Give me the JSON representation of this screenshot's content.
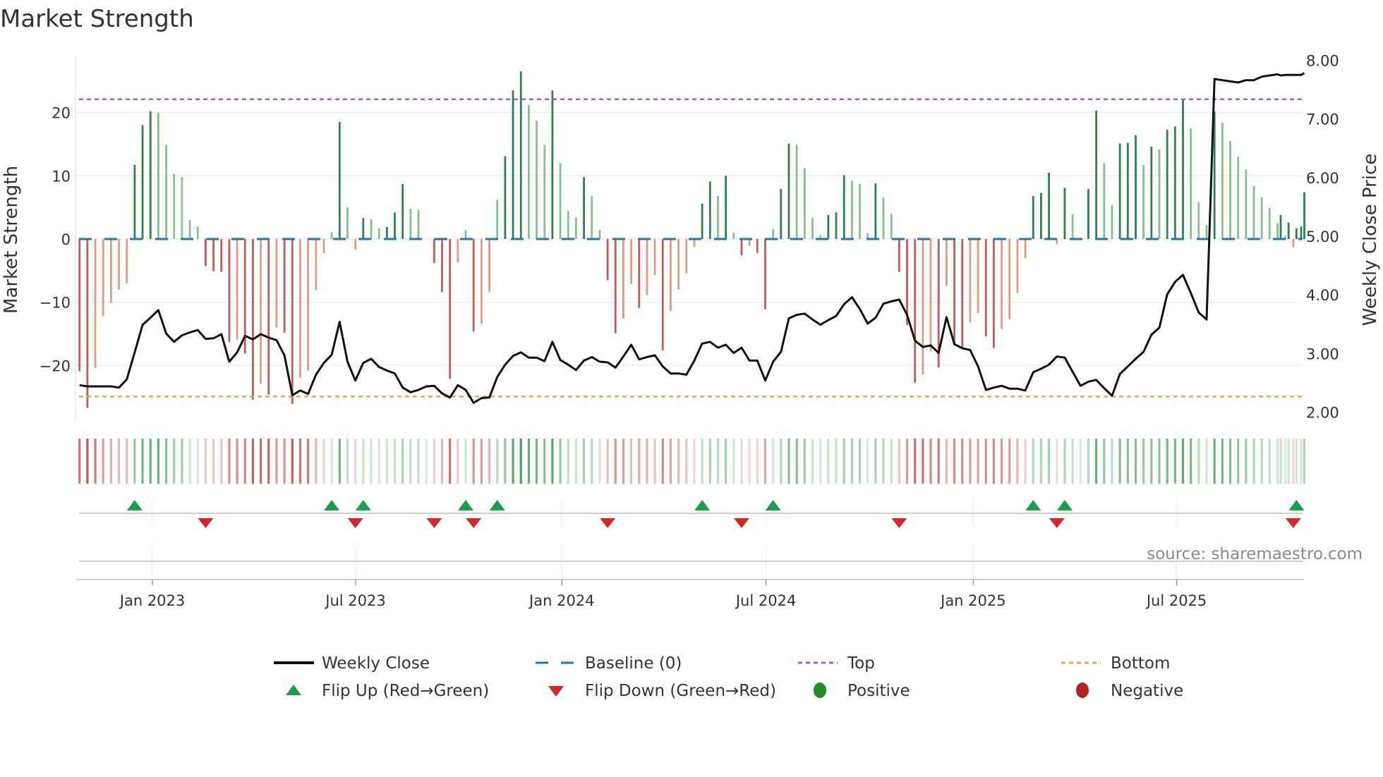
{
  "title": "Market Strength",
  "source": "source: sharemaestro.com",
  "legend": {
    "weekly_close": "Weekly Close",
    "baseline": "Baseline (0)",
    "top": "Top",
    "bottom": "Bottom",
    "flip_up": "Flip Up (Red→Green)",
    "flip_down": "Flip Down (Green→Red)",
    "positive": "Positive",
    "negative": "Negative"
  },
  "colors": {
    "pos_dark": "#2f7f50",
    "pos_light": "#86c08a",
    "neg_dark": "#c25b5b",
    "neg_light": "#e39a82",
    "baseline": "#1f77b4",
    "top": "#9b5de5",
    "bottom": "#f0a050",
    "close": "#111111",
    "flip_up": "#1a9e4a",
    "flip_down": "#d62728",
    "positive": "#228b22",
    "negative": "#b22222"
  },
  "chart_data": {
    "type": "bar",
    "title": "Market Strength",
    "ylabel": "Market Strength",
    "ylabel_right": "Weekly Close Price",
    "y_ticks": [
      "−20",
      "−10",
      "0",
      "10",
      "20"
    ],
    "y_tick_values": [
      -20,
      -10,
      0,
      10,
      20
    ],
    "ylim": [
      -28,
      28
    ],
    "y_right_ticks": [
      "2.00",
      "3.00",
      "4.00",
      "5.00",
      "6.00",
      "7.00",
      "8.00"
    ],
    "y_right_tick_values": [
      2,
      3,
      4,
      5,
      6,
      7,
      8
    ],
    "ylim_right": [
      2,
      8
    ],
    "top_level": 22.1,
    "bottom_level": -24.9,
    "baseline": 0,
    "x_unit": "weeks since first observation",
    "x_ticks": [
      {
        "label": "Jan 2023",
        "week": 9.25
      },
      {
        "label": "Jul 2023",
        "week": 35.03
      },
      {
        "label": "Jan 2024",
        "week": 61.2
      },
      {
        "label": "Jul 2024",
        "week": 87.1
      },
      {
        "label": "Jan 2025",
        "week": 113.4
      },
      {
        "label": "Jul 2025",
        "week": 139.2
      }
    ],
    "x": [
      0,
      1,
      2,
      3,
      4,
      5,
      6,
      7,
      8,
      9,
      10,
      11,
      12,
      13,
      14,
      15,
      16,
      17,
      18,
      19,
      20,
      21,
      22,
      23,
      24,
      25,
      26,
      27,
      28,
      29,
      30,
      31,
      32,
      33,
      34,
      35,
      36,
      37,
      38,
      39,
      40,
      41,
      42,
      43,
      44,
      45,
      46,
      47,
      48,
      49,
      50,
      51,
      52,
      53,
      54,
      55,
      56,
      57,
      58,
      59,
      60,
      61,
      62,
      63,
      64,
      65,
      66,
      67,
      68,
      69,
      70,
      71,
      72,
      73,
      74,
      75,
      76,
      77,
      78,
      79,
      80,
      81,
      82,
      83,
      84,
      85,
      86,
      87,
      88,
      89,
      90,
      91,
      92,
      93,
      94,
      95,
      96,
      97,
      98,
      99,
      100,
      101,
      102,
      103,
      104,
      105,
      106,
      107,
      108,
      109,
      110,
      111,
      112,
      113,
      114,
      115,
      116,
      117,
      118,
      119,
      120,
      121,
      122,
      123,
      124,
      125,
      126,
      127,
      128,
      129,
      130,
      131,
      132,
      133,
      134,
      135,
      136,
      137,
      138,
      139,
      140,
      141,
      142,
      143,
      144,
      145,
      146,
      147,
      148,
      149,
      150,
      151,
      152,
      152.4,
      153,
      153.4,
      154,
      154.4,
      155,
      155.4
    ],
    "series": [
      {
        "name": "Market Strength",
        "values": [
          -20.9,
          -26.7,
          -20.4,
          -12.2,
          -10.1,
          -8.0,
          -7.0,
          11.7,
          18.0,
          20.2,
          20.0,
          14.9,
          10.3,
          9.8,
          3.0,
          2.0,
          -4.3,
          -5.1,
          -5.2,
          -16.3,
          -15.9,
          -18.1,
          -25.4,
          -22.9,
          -24.6,
          -14.0,
          -14.8,
          -26.1,
          -21.9,
          -20.8,
          -8.1,
          -2.2,
          1.1,
          18.5,
          5.0,
          -1.7,
          3.3,
          3.1,
          1.7,
          1.9,
          4.2,
          8.7,
          4.8,
          4.6,
          0,
          -3.8,
          -8.4,
          -22.1,
          -3.7,
          1.4,
          -14.6,
          -13.4,
          -8.4,
          6.2,
          13.1,
          23.5,
          26.5,
          21.2,
          18.7,
          14.9,
          23.5,
          12.0,
          4.4,
          3.4,
          9.8,
          6.8,
          1.4,
          -6.5,
          -14.9,
          -12.6,
          -7.1,
          -10.9,
          -8.9,
          -5.7,
          -17.6,
          -11.4,
          -8.0,
          -5.4,
          -1.3,
          5.6,
          9.1,
          6.8,
          10.0,
          1.0,
          -2.6,
          -1.1,
          -2.2,
          -11.1,
          1.6,
          7.9,
          15.1,
          14.9,
          11.2,
          3.3,
          0.6,
          3.8,
          4.2,
          10.1,
          9.2,
          8.7,
          0.9,
          8.8,
          6.6,
          4.0,
          -5.2,
          -13.6,
          -22.7,
          -21.4,
          -17.8,
          -20.3,
          -7.4,
          -16.8,
          -17.2,
          -13.2,
          -11.7,
          -15.4,
          -17.2,
          -14.2,
          -12.7,
          -8.5,
          -3.0,
          6.8,
          7.3,
          10.5,
          -0.8,
          8.1,
          3.9,
          0,
          7.9,
          20.3,
          12.0,
          5.4,
          15.1,
          15.2,
          16.4,
          11.7,
          14.6,
          14.2,
          17.3,
          17.8,
          22.2,
          17.5,
          5.8,
          2.2,
          20.2,
          18.4,
          15.5,
          13.0,
          11.0,
          8.4,
          6.6,
          4.9,
          2.5,
          3.8,
          0.5,
          2.6,
          -1.3,
          1.7,
          2.0,
          7.4
        ]
      },
      {
        "name": "Weekly Close",
        "axis": "right",
        "values": [
          2.46,
          2.44,
          2.44,
          2.44,
          2.44,
          2.42,
          2.56,
          3.02,
          3.49,
          3.61,
          3.74,
          3.34,
          3.2,
          3.31,
          3.36,
          3.4,
          3.25,
          3.26,
          3.33,
          2.86,
          3.02,
          3.3,
          3.24,
          3.33,
          3.27,
          3.23,
          2.97,
          2.29,
          2.37,
          2.31,
          2.64,
          2.84,
          2.98,
          3.54,
          2.86,
          2.54,
          2.84,
          2.91,
          2.77,
          2.71,
          2.66,
          2.42,
          2.34,
          2.38,
          2.44,
          2.45,
          2.32,
          2.25,
          2.46,
          2.38,
          2.16,
          2.24,
          2.25,
          2.6,
          2.81,
          2.96,
          3.02,
          2.93,
          2.93,
          2.87,
          3.2,
          2.89,
          2.81,
          2.72,
          2.88,
          2.94,
          2.86,
          2.85,
          2.76,
          2.95,
          3.15,
          2.9,
          2.94,
          2.97,
          2.78,
          2.66,
          2.66,
          2.64,
          2.88,
          3.17,
          3.2,
          3.1,
          3.15,
          3.01,
          3.1,
          2.88,
          2.88,
          2.54,
          2.86,
          3.03,
          3.6,
          3.66,
          3.68,
          3.58,
          3.49,
          3.57,
          3.64,
          3.84,
          3.96,
          3.76,
          3.51,
          3.61,
          3.85,
          3.89,
          3.92,
          3.66,
          3.22,
          3.11,
          3.14,
          3.01,
          3.62,
          3.16,
          3.09,
          3.06,
          2.78,
          2.38,
          2.42,
          2.45,
          2.4,
          2.4,
          2.37,
          2.68,
          2.74,
          2.81,
          2.95,
          2.93,
          2.69,
          2.45,
          2.52,
          2.55,
          2.41,
          2.28,
          2.65,
          2.78,
          2.91,
          3.03,
          3.32,
          3.44,
          4.01,
          4.22,
          4.34,
          4.03,
          3.7,
          3.58,
          7.68,
          7.66,
          7.64,
          7.62,
          7.66,
          7.66,
          7.72,
          7.74,
          7.76,
          7.74,
          7.75,
          7.75,
          7.75,
          7.75,
          7.75,
          7.78
        ]
      }
    ],
    "legend_position": "bottom"
  }
}
